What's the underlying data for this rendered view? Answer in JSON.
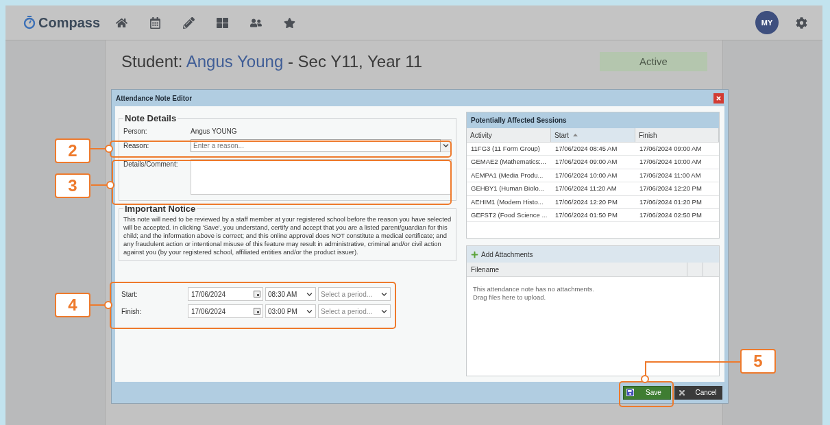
{
  "app": {
    "name": "Compass",
    "avatar": "MY"
  },
  "student": {
    "prefix": "Student:",
    "name": "Angus Young",
    "suffix": "- Sec Y11, Year 11",
    "status": "Active"
  },
  "dialog": {
    "title": "Attendance Note Editor",
    "note_details": {
      "legend": "Note Details",
      "person_label": "Person:",
      "person": "Angus YOUNG",
      "reason_label": "Reason:",
      "reason_placeholder": "Enter a reason...",
      "details_label": "Details/Comment:"
    },
    "notice": {
      "legend": "Important Notice",
      "text": "This note will need to be reviewed by a staff member at your registered school before the reason you have selected will be accepted. In clicking 'Save', you understand, certify and accept that you are a listed parent/guardian for this child; and the information above is correct; and this online approval does NOT constitute a medical certificate; and any fraudulent action or intentional misuse of this feature may result in administrative, criminal and/or civil action against you (by your registered school, affiliated entities and/or the product issuer)."
    },
    "times": [
      {
        "label": "Start:",
        "date": "17/06/2024",
        "time": "08:30 AM",
        "period_placeholder": "Select a period..."
      },
      {
        "label": "Finish:",
        "date": "17/06/2024",
        "time": "03:00 PM",
        "period_placeholder": "Select a period..."
      }
    ],
    "sessions": {
      "title": "Potentially Affected Sessions",
      "columns": [
        {
          "label": "Activity",
          "sorted": false
        },
        {
          "label": "Start",
          "sorted": true
        },
        {
          "label": "Finish",
          "sorted": false
        }
      ],
      "rows": [
        [
          "11FG3 (11 Form Group)",
          "17/06/2024 08:45 AM",
          "17/06/2024 09:00 AM"
        ],
        [
          "GEMAE2 (Mathematics:...",
          "17/06/2024 09:00 AM",
          "17/06/2024 10:00 AM"
        ],
        [
          "AEMPA1 (Media Produ...",
          "17/06/2024 10:00 AM",
          "17/06/2024 11:00 AM"
        ],
        [
          "GEHBY1 (Human Biolo...",
          "17/06/2024 11:20 AM",
          "17/06/2024 12:20 PM"
        ],
        [
          "AEHIM1 (Modern Histo...",
          "17/06/2024 12:20 PM",
          "17/06/2024 01:20 PM"
        ],
        [
          "GEFST2 (Food Science ...",
          "17/06/2024 01:50 PM",
          "17/06/2024 02:50 PM"
        ]
      ]
    },
    "attachments": {
      "button": "Add Attachments",
      "column": "Filename",
      "empty": [
        "This attendance note has no attachments.",
        "Drag files here to upload."
      ]
    },
    "buttons": [
      {
        "label": "Save",
        "kind": "save"
      },
      {
        "label": "Cancel",
        "kind": "cancel"
      }
    ]
  },
  "callouts": [
    {
      "label": "2",
      "kind": "reason"
    },
    {
      "label": "3",
      "kind": "details"
    },
    {
      "label": "4",
      "kind": "times"
    },
    {
      "label": "5",
      "kind": "save"
    }
  ]
}
